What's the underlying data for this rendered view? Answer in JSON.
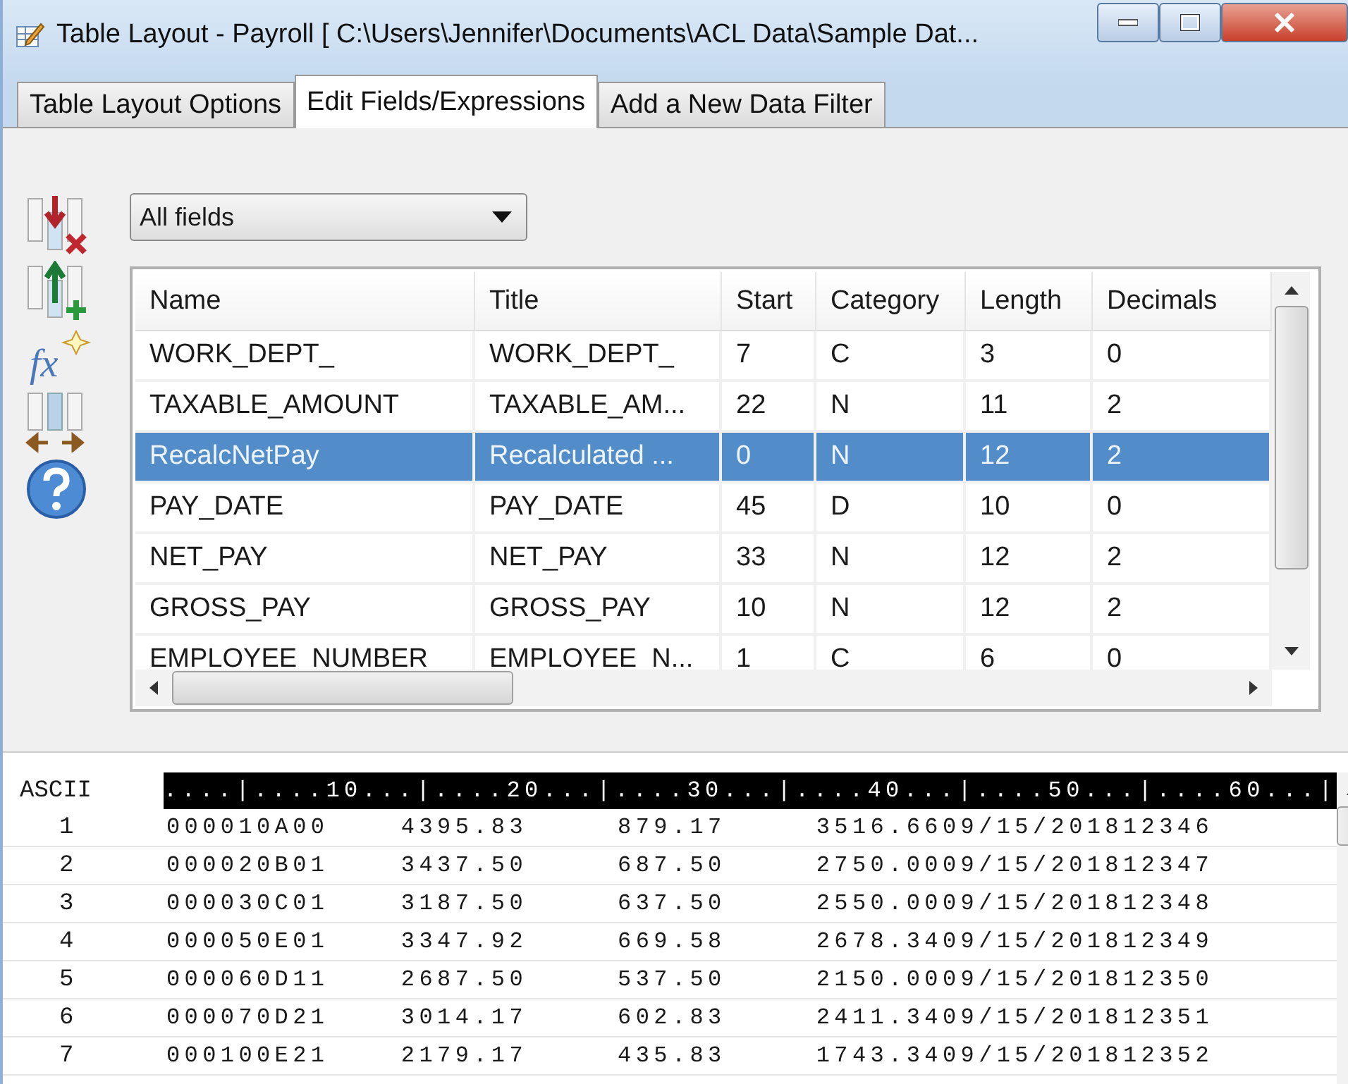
{
  "window": {
    "title": "Table Layout - Payroll [ C:\\Users\\Jennifer\\Documents\\ACL Data\\Sample Dat..."
  },
  "tabs": [
    {
      "label": "Table Layout Options",
      "selected": false
    },
    {
      "label": "Edit Fields/Expressions",
      "selected": true
    },
    {
      "label": "Add a New Data Filter",
      "selected": false
    }
  ],
  "toolbar": {
    "function_symbol": "fx"
  },
  "field_filter": {
    "value": "All fields"
  },
  "fields_table": {
    "columns": [
      "Name",
      "Title",
      "Start",
      "Category",
      "Length",
      "Decimals"
    ],
    "rows": [
      {
        "cells": [
          "WORK_DEPT_",
          "WORK_DEPT_",
          "7",
          "C",
          "3",
          "0"
        ],
        "selected": false
      },
      {
        "cells": [
          "TAXABLE_AMOUNT",
          "TAXABLE_AM...",
          "22",
          "N",
          "11",
          "2"
        ],
        "selected": false
      },
      {
        "cells": [
          "RecalcNetPay",
          "Recalculated ...",
          "0",
          "N",
          "12",
          "2"
        ],
        "selected": true
      },
      {
        "cells": [
          "PAY_DATE",
          "PAY_DATE",
          "45",
          "D",
          "10",
          "0"
        ],
        "selected": false
      },
      {
        "cells": [
          "NET_PAY",
          "NET_PAY",
          "33",
          "N",
          "12",
          "2"
        ],
        "selected": false
      },
      {
        "cells": [
          "GROSS_PAY",
          "GROSS_PAY",
          "10",
          "N",
          "12",
          "2"
        ],
        "selected": false
      },
      {
        "cells": [
          "EMPLOYEE_NUMBER",
          "EMPLOYEE_N...",
          "1",
          "C",
          "6",
          "0"
        ],
        "selected": false
      }
    ]
  },
  "record_view": {
    "label": "ASCII",
    "ruler": "....|....10...|....20...|....30...|....40...|....50...|....60...|",
    "rows": [
      {
        "number": "1",
        "text": "000010A00    4395.83     879.17     3516.6609/15/201812346"
      },
      {
        "number": "2",
        "text": "000020B01    3437.50     687.50     2750.0009/15/201812347"
      },
      {
        "number": "3",
        "text": "000030C01    3187.50     637.50     2550.0009/15/201812348"
      },
      {
        "number": "4",
        "text": "000050E01    3347.92     669.58     2678.3409/15/201812349"
      },
      {
        "number": "5",
        "text": "000060D11    2687.50     537.50     2150.0009/15/201812350"
      },
      {
        "number": "6",
        "text": "000070D21    3014.17     602.83     2411.3409/15/201812351"
      },
      {
        "number": "7",
        "text": "000100E21    2179.17     435.83     1743.3409/15/201812352"
      }
    ]
  }
}
